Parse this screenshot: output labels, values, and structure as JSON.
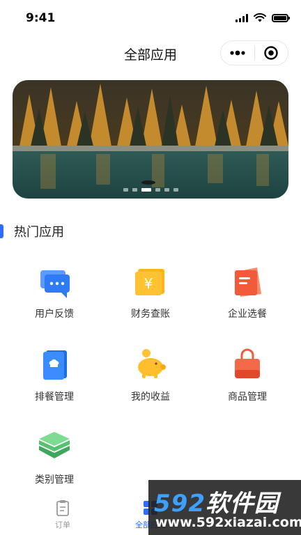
{
  "status_bar": {
    "time": "9:41"
  },
  "nav": {
    "title": "全部应用"
  },
  "banner": {
    "slide_count": 6,
    "active_slide": 3
  },
  "section": {
    "title": "热门应用"
  },
  "apps": [
    {
      "label": "用户反馈",
      "icon": "chat-bubble-icon"
    },
    {
      "label": "财务查账",
      "icon": "yen-wallet-icon"
    },
    {
      "label": "企业选餐",
      "icon": "menu-card-icon"
    },
    {
      "label": "排餐管理",
      "icon": "chef-book-icon"
    },
    {
      "label": "我的收益",
      "icon": "piggy-bank-icon"
    },
    {
      "label": "商品管理",
      "icon": "shopping-bag-icon"
    },
    {
      "label": "类别管理",
      "icon": "layers-icon"
    }
  ],
  "tabs": [
    {
      "label": "订单",
      "icon": "clipboard-icon",
      "active": false
    },
    {
      "label": "全部应用",
      "icon": "grid-icon",
      "active": true
    }
  ],
  "watermark": {
    "line1_num": "592",
    "line1_cn": "软件园",
    "line2": "www.592xiazai.com"
  },
  "colors": {
    "accent": "#2f6bff",
    "text": "#222222",
    "muted": "#999999"
  }
}
